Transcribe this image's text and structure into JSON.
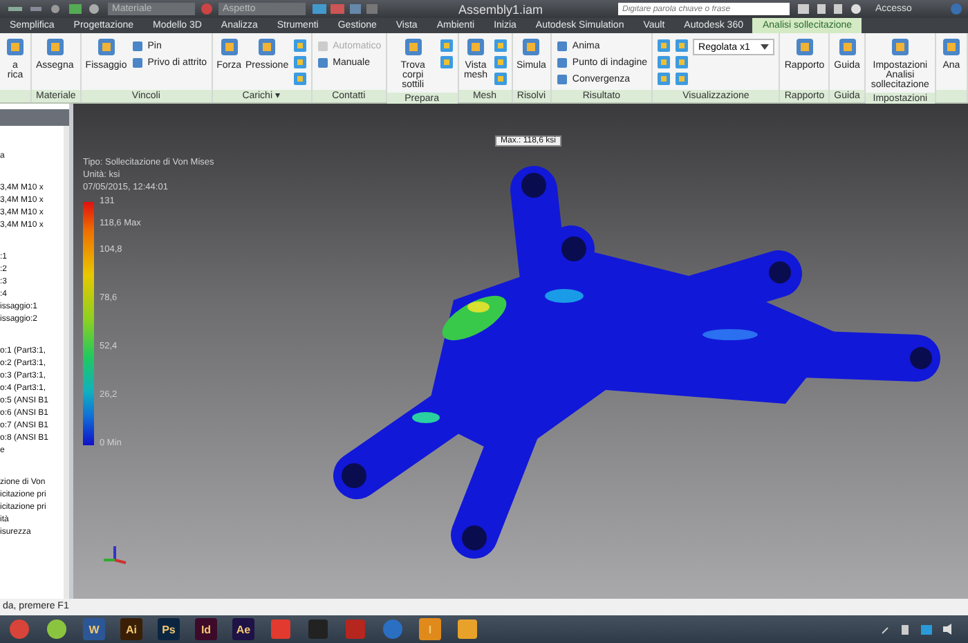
{
  "title_bar": {
    "material": "Materiale",
    "appearance": "Aspetto",
    "title": "Assembly1.iam",
    "search_placeholder": "Digitare parola chiave o frase",
    "account": "Accesso"
  },
  "tabs": [
    {
      "label": "Semplifica",
      "selected": false
    },
    {
      "label": "Progettazione",
      "selected": false
    },
    {
      "label": "Modello 3D",
      "selected": false
    },
    {
      "label": "Analizza",
      "selected": false
    },
    {
      "label": "Strumenti",
      "selected": false
    },
    {
      "label": "Gestione",
      "selected": false
    },
    {
      "label": "Vista",
      "selected": false
    },
    {
      "label": "Ambienti",
      "selected": false
    },
    {
      "label": "Inizia",
      "selected": false
    },
    {
      "label": "Autodesk Simulation",
      "selected": false
    },
    {
      "label": "Vault",
      "selected": false
    },
    {
      "label": "Autodesk 360",
      "selected": false
    },
    {
      "label": "Analisi sollecitazione",
      "selected": true
    }
  ],
  "ribbon": [
    {
      "tools": [
        {
          "kind": "big",
          "label": "a\nrica",
          "disabled": false
        }
      ]
    },
    {
      "label": "Materiale",
      "tools": [
        {
          "kind": "big",
          "label": "Assegna",
          "disabled": false
        }
      ]
    },
    {
      "label": "Vincoli",
      "tools": [
        {
          "kind": "big",
          "label": "Fissaggio",
          "disabled": false
        },
        {
          "kind": "small",
          "label": "Pin",
          "disabled": false
        },
        {
          "kind": "small",
          "label": "Privo di attrito",
          "disabled": false
        }
      ]
    },
    {
      "label": "Carichi ▾",
      "tools": [
        {
          "kind": "big",
          "label": "Forza",
          "disabled": false
        },
        {
          "kind": "big",
          "label": "Pressione",
          "disabled": false
        },
        {
          "kind": "icon",
          "disabled": false
        },
        {
          "kind": "icon",
          "disabled": false
        },
        {
          "kind": "icon",
          "disabled": false
        }
      ]
    },
    {
      "label": "Contatti",
      "tools": [
        {
          "kind": "small",
          "label": "Automatico",
          "disabled": true
        },
        {
          "kind": "small",
          "label": "Manuale",
          "disabled": false
        }
      ]
    },
    {
      "label": "Prepara",
      "tools": [
        {
          "kind": "big",
          "label": "Trova corpi sottili",
          "disabled": false
        },
        {
          "kind": "icon",
          "disabled": false
        },
        {
          "kind": "icon",
          "disabled": false
        }
      ]
    },
    {
      "label": "Mesh",
      "tools": [
        {
          "kind": "big",
          "label": "Vista mesh",
          "disabled": false
        },
        {
          "kind": "icon",
          "disabled": false
        },
        {
          "kind": "icon",
          "disabled": false
        },
        {
          "kind": "icon",
          "disabled": false
        }
      ]
    },
    {
      "label": "Risolvi",
      "tools": [
        {
          "kind": "big",
          "label": "Simula",
          "disabled": false
        }
      ]
    },
    {
      "label": "Risultato",
      "tools": [
        {
          "kind": "small",
          "label": "Anima",
          "disabled": false
        },
        {
          "kind": "small",
          "label": "Punto di indagine",
          "disabled": false
        },
        {
          "kind": "small",
          "label": "Convergenza",
          "disabled": false
        }
      ]
    },
    {
      "label": "Visualizzazione",
      "tools": [
        {
          "kind": "icon",
          "disabled": false
        },
        {
          "kind": "icon",
          "disabled": false
        },
        {
          "kind": "icon",
          "disabled": false
        },
        {
          "kind": "icon",
          "disabled": false
        },
        {
          "kind": "icon",
          "disabled": false
        },
        {
          "kind": "icon",
          "disabled": false
        },
        {
          "kind": "dropdown",
          "label": "Regolata x1",
          "disabled": false
        }
      ]
    },
    {
      "label": "Rapporto",
      "tools": [
        {
          "kind": "big",
          "label": "Rapporto",
          "disabled": false
        }
      ]
    },
    {
      "label": "Guida",
      "tools": [
        {
          "kind": "big",
          "label": "Guida",
          "disabled": false
        }
      ]
    },
    {
      "label": "Impostazioni",
      "tools": [
        {
          "kind": "big",
          "label": "Impostazioni\nAnalisi sollecitazione",
          "disabled": false
        }
      ]
    },
    {
      "tools": [
        {
          "kind": "big",
          "label": "Ana",
          "disabled": false
        }
      ]
    }
  ],
  "browser": {
    "groups": [
      [
        "a"
      ],
      [
        "3,4M M10 x",
        "3,4M M10 x",
        "3,4M M10 x",
        "3,4M M10 x"
      ],
      [
        ":1",
        ":2",
        ":3",
        ":4",
        "issaggio:1",
        "issaggio:2"
      ],
      [
        "o:1 (Part3:1,",
        "o:2 (Part3:1,",
        "o:3 (Part3:1,",
        "o:4 (Part3:1,",
        "o:5 (ANSI B1",
        "o:6 (ANSI B1",
        "o:7 (ANSI B1",
        "o:8 (ANSI B1",
        "e"
      ],
      [
        "zione di Von",
        "icitazione pri",
        "icitazione pri",
        "ità",
        "isurezza"
      ]
    ]
  },
  "legend": {
    "lines": [
      "Tipo: Sollecitazione di Von Mises",
      "Unità: ksi",
      "07/05/2015, 12:44:01"
    ],
    "labels": [
      {
        "kind": "tick",
        "text": "131"
      },
      {
        "kind": "marker",
        "text": "118,6 Max"
      },
      {
        "kind": "tick",
        "text": "104,8"
      },
      {
        "kind": "tick",
        "text": "78,6"
      },
      {
        "kind": "tick",
        "text": "52,4"
      },
      {
        "kind": "tick",
        "text": "26,2"
      },
      {
        "kind": "tick",
        "text": "0 Min"
      }
    ]
  },
  "max_probe": "Max.: 118,6 ksi",
  "status_bar": "da, premere F1",
  "taskbar": [
    {
      "kind": "round",
      "color": "#d8443a"
    },
    {
      "kind": "round",
      "color": "#8bc53f"
    },
    {
      "kind": "tile",
      "label": "W",
      "color": "#2b5797"
    },
    {
      "kind": "tile",
      "label": "Ai",
      "color": "#3a1f06"
    },
    {
      "kind": "tile",
      "label": "Ps",
      "color": "#0b2541"
    },
    {
      "kind": "tile",
      "label": "Id",
      "color": "#3d0a29"
    },
    {
      "kind": "tile",
      "label": "Ae",
      "color": "#1f1247"
    },
    {
      "kind": "square",
      "color": "#e23a2e"
    },
    {
      "kind": "square",
      "color": "#222222"
    },
    {
      "kind": "square",
      "color": "#b5261e"
    },
    {
      "kind": "round",
      "color": "#2b6fc2"
    },
    {
      "kind": "tile",
      "label": "I",
      "color": "#e08a1c"
    },
    {
      "kind": "square",
      "color": "#e8a22a"
    }
  ]
}
